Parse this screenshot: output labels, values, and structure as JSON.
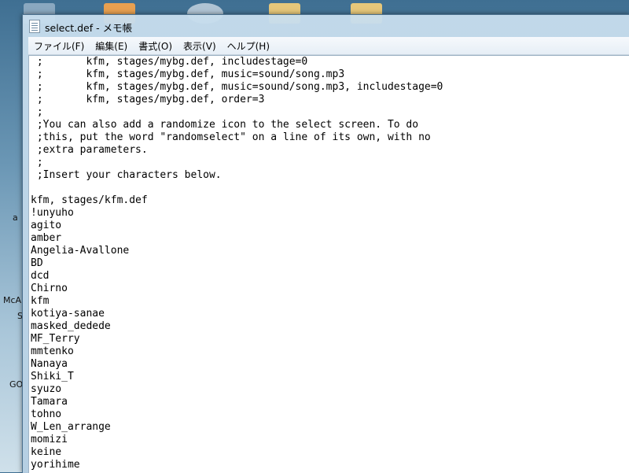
{
  "window": {
    "title": "select.def - メモ帳"
  },
  "menu": [
    {
      "label": "ファイル(F)"
    },
    {
      "label": "編集(E)"
    },
    {
      "label": "書式(O)"
    },
    {
      "label": "表示(V)"
    },
    {
      "label": "ヘルプ(H)"
    }
  ],
  "desktop": {
    "labels": [
      "a",
      "McA",
      "S",
      "GO"
    ]
  },
  "editor": {
    "lines": [
      " ;       kfm, stages/mybg.def, includestage=0",
      " ;       kfm, stages/mybg.def, music=sound/song.mp3",
      " ;       kfm, stages/mybg.def, music=sound/song.mp3, includestage=0",
      " ;       kfm, stages/mybg.def, order=3",
      " ;",
      " ;You can also add a randomize icon to the select screen. To do",
      " ;this, put the word \"randomselect\" on a line of its own, with no",
      " ;extra parameters.",
      " ;",
      " ;Insert your characters below.",
      "",
      "kfm, stages/kfm.def",
      "!unyuho",
      "agito",
      "amber",
      "Angelia-Avallone",
      "BD",
      "dcd",
      "Chirno",
      "kfm",
      "kotiya-sanae",
      "masked_dedede",
      "MF_Terry",
      "mmtenko",
      "Nanaya",
      "Shiki_T",
      "syuzo",
      "Tamara",
      "tohno",
      "W_Len_arrange",
      "momizi",
      "keine",
      "yorihime"
    ]
  }
}
